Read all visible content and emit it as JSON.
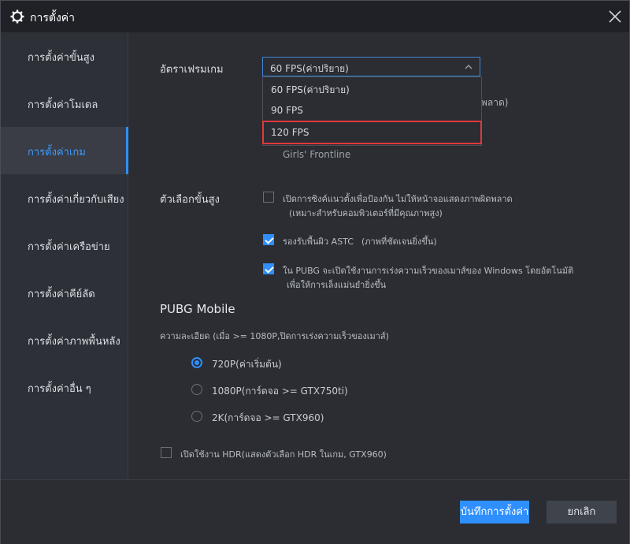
{
  "window": {
    "title": "การตั้งค่า"
  },
  "sidebar": {
    "items": [
      {
        "label": "การตั้งค่าขั้นสูง"
      },
      {
        "label": "การตั้งค่าโมเดล"
      },
      {
        "label": "การตั้งค่าเกม"
      },
      {
        "label": "การตั้งค่าเกี่ยวกับเสียง"
      },
      {
        "label": "การตั้งค่าเครือข่าย"
      },
      {
        "label": "การตั้งค่าคีย์ลัด"
      },
      {
        "label": "การตั้งค่าภาพพื้นหลัง"
      },
      {
        "label": "การตั้งค่าอื่น ๆ"
      }
    ],
    "active_index": 2
  },
  "frame_rate": {
    "label": "อัตราเฟรมเกม",
    "selected": "60 FPS(ค่าปริยาย)",
    "options": [
      "60 FPS(ค่าปริยาย)",
      "90 FPS",
      "120 FPS"
    ],
    "partial_hint": "พลาด)",
    "game_note": "Girls' Frontline"
  },
  "advanced": {
    "label": "ตัวเลือกขั้นสูง",
    "opt1_line1": "เปิดการซิงค์แนวตั้งเพื่อป้องกัน ไม่ให้หน้าจอแสดงภาพผิดพลาด",
    "opt1_line2": "(เหมาะสำหรับคอมพิวเตอร์ที่มีคุณภาพสูง)",
    "opt2": "รองรับพื้นผิว ASTC",
    "opt2_note": "(ภาพที่ชัดเจนยิ่งขึ้น)",
    "opt3_line1": "ใน PUBG จะเปิดใช้งานการเร่งความเร็วของเมาส์ของ Windows โดยอัตโนมัติ",
    "opt3_line2": "เพื่อให้การเล็งแม่นยำยิ่งขึ้น"
  },
  "pubg": {
    "title": "PUBG Mobile",
    "resolution_label": "ความละเอียด (เมื่อ >= 1080P,ปิดการเร่งความเร็วของเมาส์)",
    "options": [
      "720P(ค่าเริ่มต้น)",
      "1080P(การ์ดจอ >= GTX750ti)",
      "2K(การ์ดจอ >= GTX960)"
    ],
    "hdr_label": "เปิดใช้งาน HDR(แสดงตัวเลือก HDR ในเกม, GTX960)"
  },
  "footer": {
    "save": "บันทึกการตั้งค่า",
    "cancel": "ยกเลิก"
  },
  "colors": {
    "accent": "#2f8fff",
    "highlight": "#e0393b",
    "background": "#2b2d33",
    "titlebar": "#1f2126"
  }
}
